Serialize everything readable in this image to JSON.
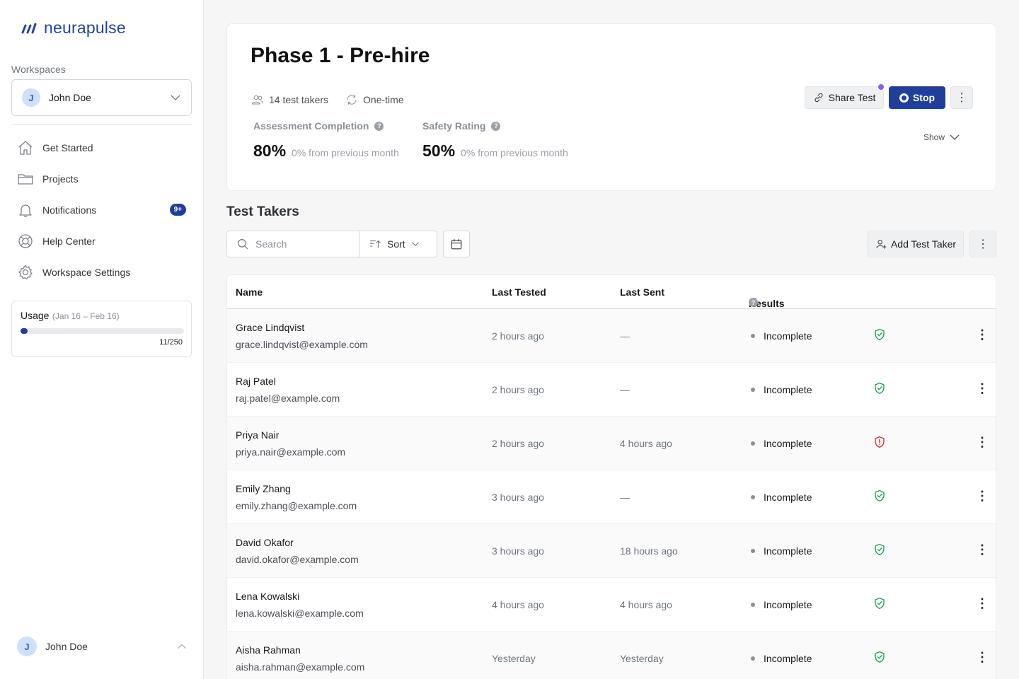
{
  "brand": {
    "name": "neurapulse",
    "color": "#2442a4"
  },
  "sidebar": {
    "workspaces_label": "Workspaces",
    "workspace": {
      "initial": "J",
      "name": "John Doe"
    },
    "items": [
      {
        "label": "Get Started",
        "icon": "home-icon"
      },
      {
        "label": "Projects",
        "icon": "folder-icon"
      },
      {
        "label": "Notifications",
        "icon": "bell-icon",
        "badge": "9+"
      },
      {
        "label": "Help Center",
        "icon": "lifebuoy-icon"
      },
      {
        "label": "Workspace Settings",
        "icon": "gear-icon"
      }
    ],
    "usage": {
      "title": "Usage",
      "range": "(Jan 16 – Feb 16)",
      "count": "11/250",
      "progress": 0.044
    },
    "user": {
      "initial": "J",
      "name": "John Doe"
    }
  },
  "header": {
    "title": "Phase 1 - Pre-hire",
    "test_takers": "14 test takers",
    "frequency": "One-time",
    "metrics": [
      {
        "label": "Assessment Completion",
        "value": "80%",
        "change": "0% from previous month"
      },
      {
        "label": "Safety Rating",
        "value": "50%",
        "change": "0% from previous month"
      }
    ],
    "share_label": "Share Test",
    "stop_label": "Stop",
    "show_label": "Show"
  },
  "takers": {
    "title": "Test Takers",
    "search_placeholder": "Search",
    "sort_label": "Sort",
    "add_label": "Add Test Taker",
    "columns": {
      "name": "Name",
      "last_tested": "Last Tested",
      "last_sent": "Last Sent",
      "results": "Results"
    },
    "rows": [
      {
        "name": "Grace Lindqvist",
        "email": "grace.lindqvist@example.com",
        "last_tested": "2 hours ago",
        "last_sent": "—",
        "result": "Incomplete",
        "safety": "safe"
      },
      {
        "name": "Raj Patel",
        "email": "raj.patel@example.com",
        "last_tested": "2 hours ago",
        "last_sent": "—",
        "result": "Incomplete",
        "safety": "safe"
      },
      {
        "name": "Priya Nair",
        "email": "priya.nair@example.com",
        "last_tested": "2 hours ago",
        "last_sent": "4 hours ago",
        "result": "Incomplete",
        "safety": "alert"
      },
      {
        "name": "Emily Zhang",
        "email": "emily.zhang@example.com",
        "last_tested": "3 hours ago",
        "last_sent": "—",
        "result": "Incomplete",
        "safety": "safe"
      },
      {
        "name": "David Okafor",
        "email": "david.okafor@example.com",
        "last_tested": "3 hours ago",
        "last_sent": "18 hours ago",
        "result": "Incomplete",
        "safety": "safe"
      },
      {
        "name": "Lena Kowalski",
        "email": "lena.kowalski@example.com",
        "last_tested": "4 hours ago",
        "last_sent": "4 hours ago",
        "result": "Incomplete",
        "safety": "safe"
      },
      {
        "name": "Aisha Rahman",
        "email": "aisha.rahman@example.com",
        "last_tested": "Yesterday",
        "last_sent": "Yesterday",
        "result": "Incomplete",
        "safety": "safe"
      }
    ]
  },
  "colors": {
    "primary": "#1f3f9a",
    "safe": "#16a34a",
    "alert": "#dc2626",
    "accent_dot": "#8b5cf6"
  }
}
